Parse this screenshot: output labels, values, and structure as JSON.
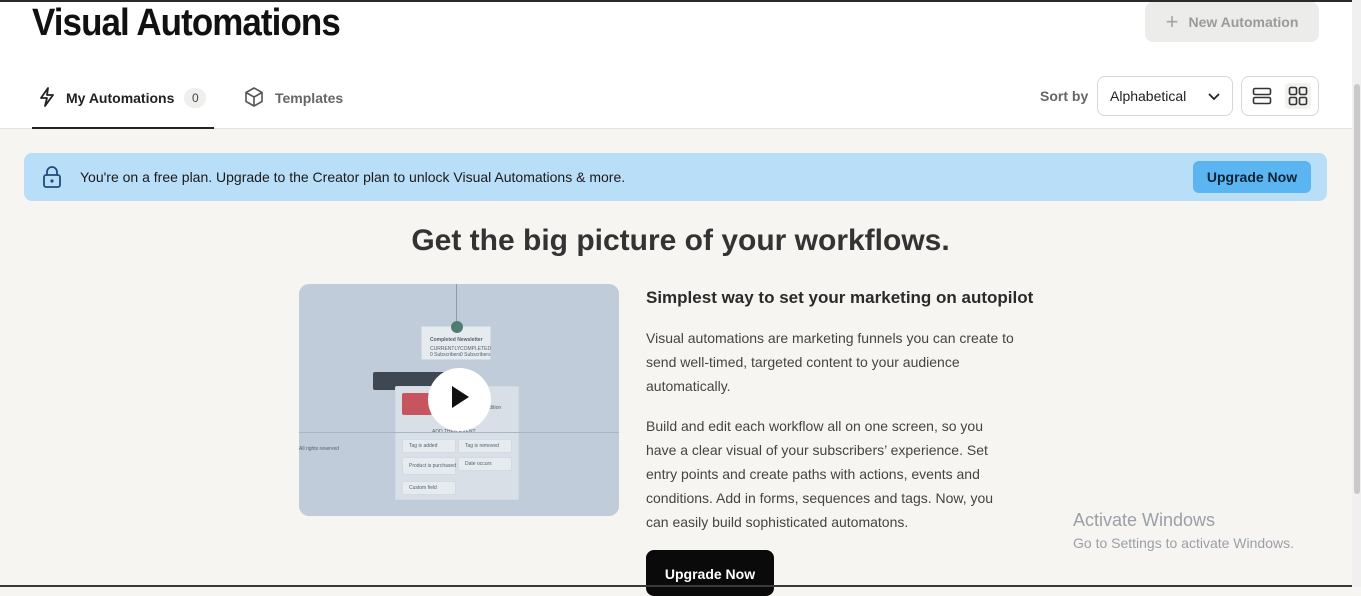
{
  "header": {
    "title": "Visual Automations",
    "new_automation_label": "New Automation"
  },
  "tabs": [
    {
      "label": "My Automations",
      "count": "0",
      "icon": "lightning-icon",
      "active": true
    },
    {
      "label": "Templates",
      "icon": "cube-icon",
      "active": false
    }
  ],
  "sort": {
    "label": "Sort by",
    "selected": "Alphabetical",
    "icon": "chevron-down-icon"
  },
  "view_toggle": {
    "options": [
      "list-view-icon",
      "grid-view-icon"
    ],
    "active": "grid-view-icon"
  },
  "banner": {
    "text": "You're on a free plan. Upgrade to the Creator plan to unlock Visual Automations & more.",
    "button_label": "Upgrade Now",
    "icon": "lock-icon",
    "background_color": "#b9def7",
    "button_color": "#5ab5f0"
  },
  "hero": {
    "title": "Get the big picture of your workflows.",
    "heading": "Simplest way to set your marketing on autopilot",
    "paragraph_1": "Visual automations are marketing funnels you can create to send well-timed, targeted content to your audience automatically.",
    "paragraph_2": "Build and edit each workflow all on one screen, so you have a clear visual of your subscribers’ experience. Set entry points and create paths with actions, events and conditions. Add in forms, sequences and tags. Now, you can easily build sophisticated automatons.",
    "button_label": "Upgrade Now"
  },
  "video": {
    "play_icon": "play-icon",
    "preview": {
      "node_title": "Completed Newsletter",
      "node_left_top": "CURRENTLY",
      "node_left_bottom": "0 Subscribers",
      "node_right_top": "COMPLETED",
      "node_right_bottom": "0 Subscribers",
      "side_label": "All rights reserved",
      "condition_label": "Condition",
      "add_label": "ADD THEN EVENT...",
      "items": [
        "Tag is added",
        "Tag is removed",
        "Product is purchased",
        "Date occurs",
        "Custom field"
      ]
    }
  },
  "watermark": {
    "title": "Activate Windows",
    "subtitle": "Go to Settings to activate Windows."
  }
}
